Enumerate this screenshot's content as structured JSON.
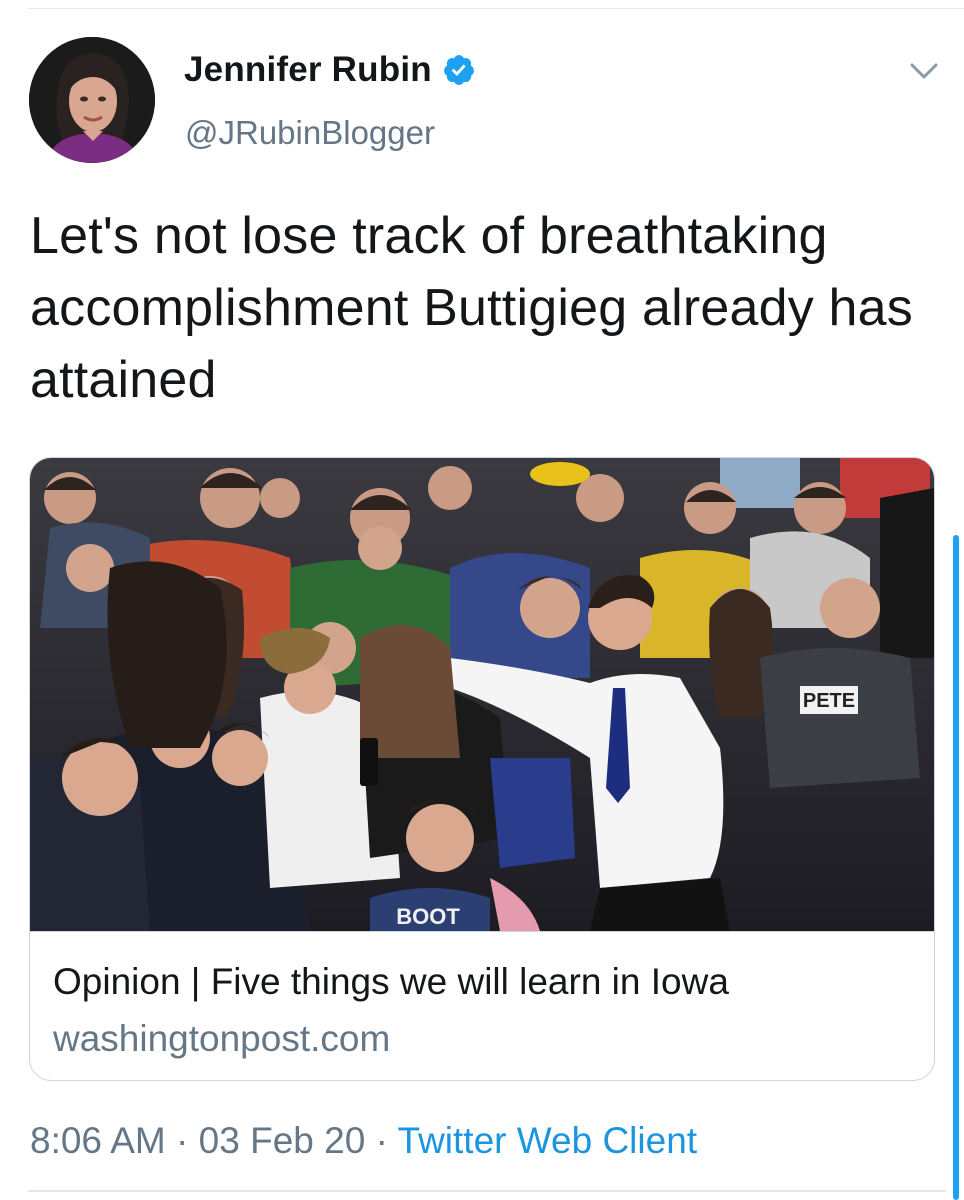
{
  "tweet": {
    "author": {
      "display_name": "Jennifer Rubin",
      "handle": "@JRubinBlogger",
      "verified": true
    },
    "text": "Let's not lose track of breathtaking accomplishment Buttigieg already has attained",
    "menu_icon": "chevron-down-icon",
    "card": {
      "title": "Opinion | Five things we will learn in Iowa",
      "domain": "washingtonpost.com",
      "image_signs": [
        "PETE",
        "BOOT"
      ]
    },
    "meta": {
      "time": "8:06 AM",
      "separator": "·",
      "date": "03 Feb 20",
      "source": "Twitter Web Client"
    }
  },
  "colors": {
    "text": "#14171a",
    "secondary": "#657786",
    "link": "#1b95e0",
    "verified": "#1da1f2",
    "border": "#ccd6dd"
  }
}
